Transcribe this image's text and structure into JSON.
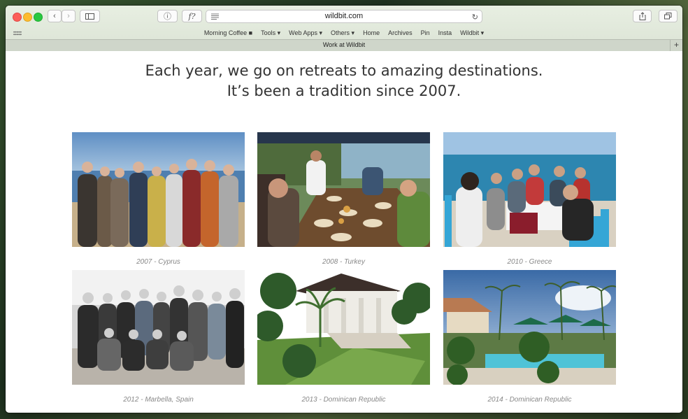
{
  "browser": {
    "url": "wildbit.com",
    "reader_button": "ⓘ",
    "formula_button": "f?",
    "favorites": [
      {
        "label": "Morning Coffee ■"
      },
      {
        "label": "Tools ▾"
      },
      {
        "label": "Web Apps ▾"
      },
      {
        "label": "Others ▾"
      },
      {
        "label": "Home"
      },
      {
        "label": "Archives"
      },
      {
        "label": "Pin"
      },
      {
        "label": "Insta"
      },
      {
        "label": "Wildbit ▾"
      }
    ],
    "tab_title": "Work at Wildbit",
    "new_tab": "+"
  },
  "page": {
    "headline_line1": "Each year, we go on retreats to amazing destinations.",
    "headline_line2": "It’s been a tradition since 2007.",
    "retreats": [
      {
        "caption": "2007 - Cyprus"
      },
      {
        "caption": "2008 - Turkey"
      },
      {
        "caption": "2010 - Greece"
      },
      {
        "caption": "2012 - Marbella, Spain"
      },
      {
        "caption": "2013 - Dominican Republic"
      },
      {
        "caption": "2014 - Dominican Republic"
      }
    ]
  }
}
